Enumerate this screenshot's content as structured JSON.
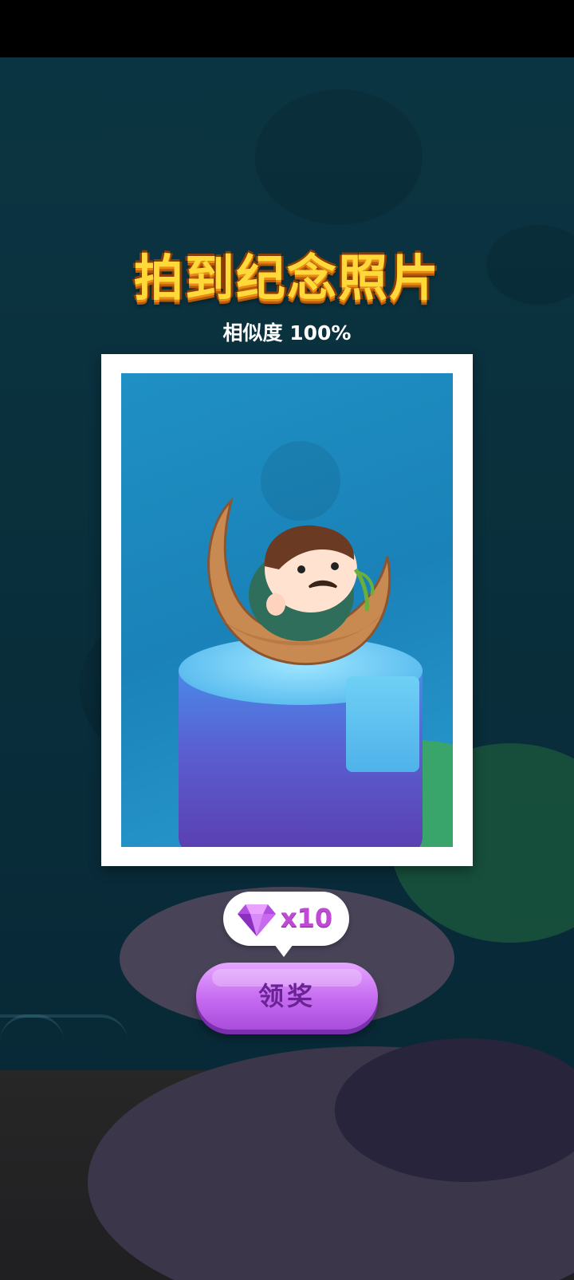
{
  "title": "拍到纪念照片",
  "similarity_text": "相似度 100%",
  "reward": {
    "icon": "purple-gem-icon",
    "count_text": "x10"
  },
  "claim_button_label": "领奖",
  "colors": {
    "title_yellow": "#ffd83a",
    "button_purple": "#c56af0",
    "reward_text": "#c04ad6",
    "background": "#0d3a4a"
  }
}
